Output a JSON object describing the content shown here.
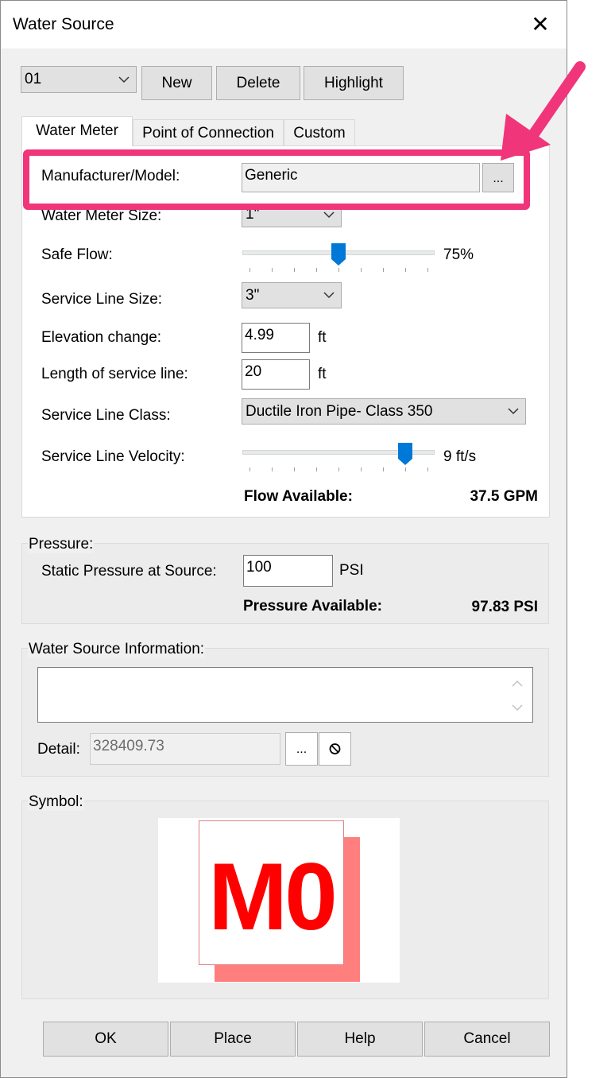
{
  "window": {
    "title": "Water Source",
    "close_glyph": "✕"
  },
  "toolbar": {
    "source_select": "01",
    "new_label": "New",
    "delete_label": "Delete",
    "highlight_label": "Highlight"
  },
  "tabs": [
    {
      "label": "Water Meter",
      "active": true
    },
    {
      "label": "Point of Connection",
      "active": false
    },
    {
      "label": "Custom",
      "active": false
    }
  ],
  "water_meter": {
    "manufacturer_label": "Manufacturer/Model:",
    "manufacturer_value": "Generic",
    "browse_label": "...",
    "meter_size_label": "Water Meter Size:",
    "meter_size_value": "1\"",
    "safe_flow_label": "Safe Flow:",
    "safe_flow_value": "75%",
    "safe_flow_fraction": 0.5,
    "service_line_size_label": "Service Line Size:",
    "service_line_size_value": "3\"",
    "elevation_label": "Elevation change:",
    "elevation_value": "4.99",
    "elevation_unit": "ft",
    "length_label": "Length of service line:",
    "length_value": "20",
    "length_unit": "ft",
    "class_label": "Service Line Class:",
    "class_value": "Ductile Iron Pipe- Class 350",
    "velocity_label": "Service Line Velocity:",
    "velocity_value": "9 ft/s",
    "velocity_fraction": 0.875,
    "flow_available_label": "Flow Available:",
    "flow_available_value": "37.5 GPM"
  },
  "pressure": {
    "group_label": "Pressure:",
    "static_label": "Static Pressure at Source:",
    "static_value": "100",
    "static_unit": "PSI",
    "available_label": "Pressure Available:",
    "available_value": "97.83 PSI"
  },
  "info": {
    "group_label": "Water Source Information:",
    "text": "",
    "detail_label": "Detail:",
    "detail_value": "328409.73",
    "detail_browse": "...",
    "clear_glyph": "⃠"
  },
  "symbol": {
    "group_label": "Symbol:",
    "text": "M0",
    "color": "#ff0000",
    "shadow_color": "#ff7f7f"
  },
  "footer": {
    "ok_label": "OK",
    "place_label": "Place",
    "help_label": "Help",
    "cancel_label": "Cancel"
  },
  "annotation": {
    "color": "#f0357a"
  }
}
